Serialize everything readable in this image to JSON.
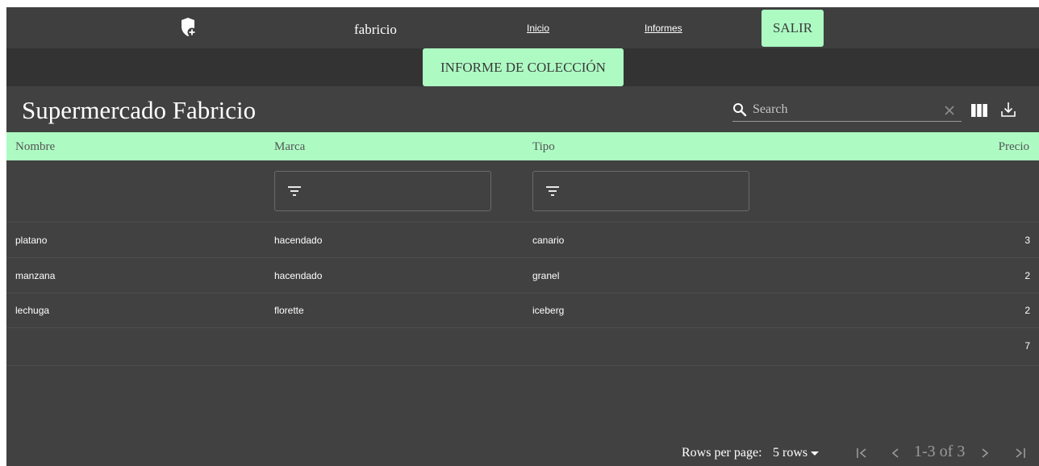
{
  "navbar": {
    "logo_icon": "shield-plus-icon",
    "brand": "fabricio",
    "links": {
      "inicio": "Inicio",
      "informes": "Informes"
    },
    "logout_label": "SALIR"
  },
  "subbar": {
    "report_button": "INFORME DE COLECCIÓN"
  },
  "table": {
    "title": "Supermercado Fabricio",
    "search_placeholder": "Search",
    "columns": [
      "Nombre",
      "Marca",
      "Tipo",
      "Precio"
    ],
    "rows": [
      {
        "nombre": "platano",
        "marca": "hacendado",
        "tipo": "canario",
        "precio": "3"
      },
      {
        "nombre": "manzana",
        "marca": "hacendado",
        "tipo": "granel",
        "precio": "2"
      },
      {
        "nombre": "lechuga",
        "marca": "florette",
        "tipo": "iceberg",
        "precio": "2"
      },
      {
        "nombre": "",
        "marca": "",
        "tipo": "",
        "precio": "7"
      }
    ],
    "footer": {
      "rows_per_page_label": "Rows per page:",
      "rows_per_page_value": "5 rows",
      "range": "1-3 of 3"
    }
  },
  "colors": {
    "accent": "#adfbc3",
    "background": "#414141",
    "navbar": "#3f3f3f",
    "subbar": "#333333"
  }
}
